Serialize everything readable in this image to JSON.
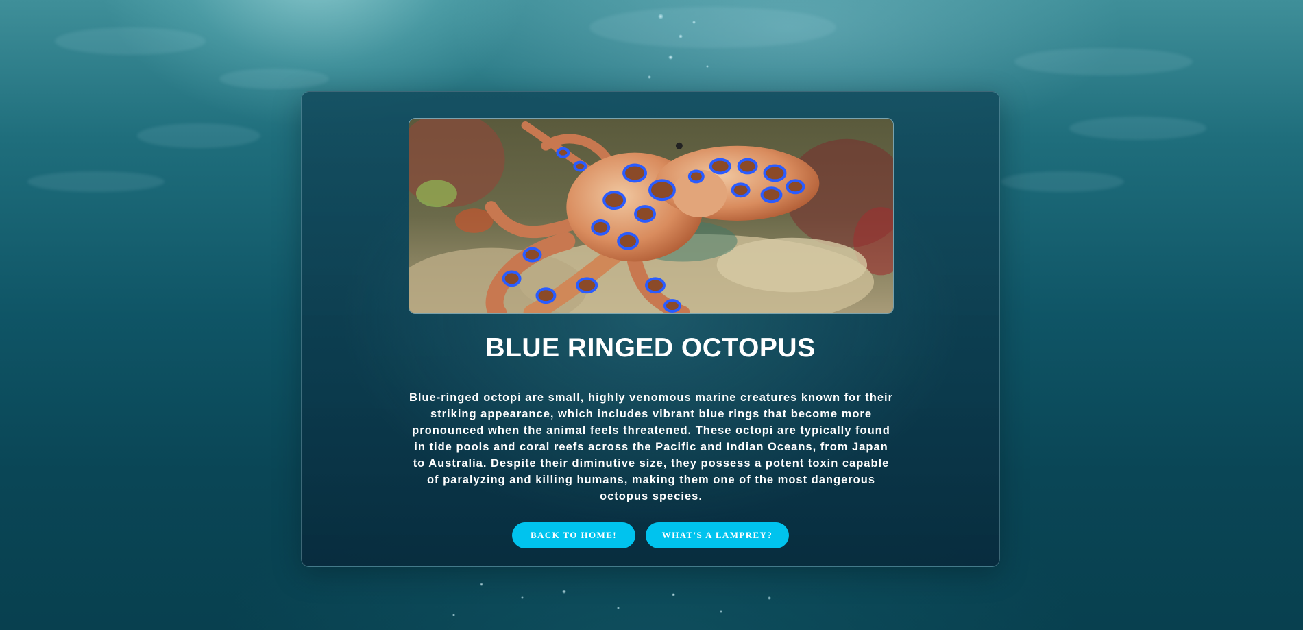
{
  "page": {
    "background": "underwater-ocean-scene"
  },
  "card": {
    "image": {
      "subject": "blue-ringed octopus on coral reef",
      "alt": ""
    },
    "title": "BLUE RINGED OCTOPUS",
    "description": "Blue-ringed octopi are small, highly venomous marine creatures known for their striking appearance, which includes vibrant blue rings that become more pronounced when the animal feels threatened. These octopi are typically found in tide pools and coral reefs across the Pacific and Indian Oceans, from Japan to Australia. Despite their diminutive size, they possess a potent toxin capable of paralyzing and killing humans, making them one of the most dangerous octopus species.",
    "buttons": [
      {
        "label": "BACK TO HOME!"
      },
      {
        "label": "WHAT'S A LAMPREY?"
      }
    ]
  },
  "colors": {
    "button_bg": "#00c3ee",
    "text": "#ffffff",
    "ring_blue": "#2a5cff"
  }
}
